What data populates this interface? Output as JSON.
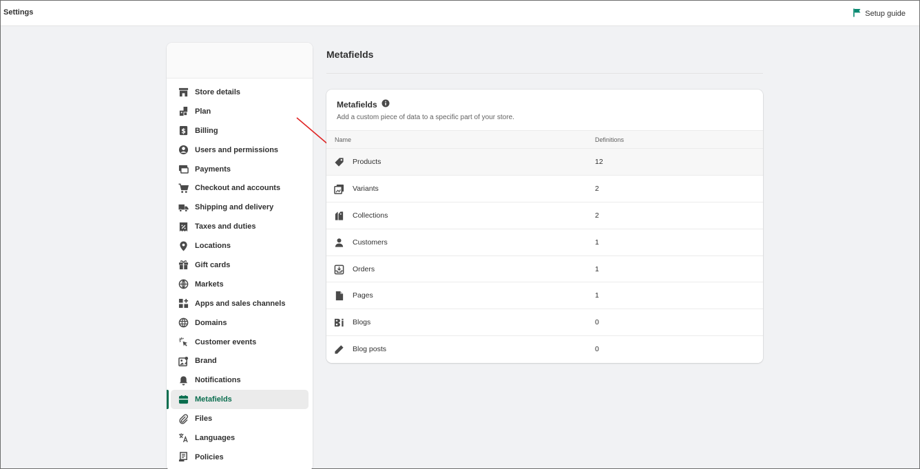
{
  "topbar": {
    "title": "Settings",
    "setup_guide_label": "Setup guide",
    "setup_guide_icon": "flag-icon",
    "accent": "#0b8a72"
  },
  "sidebar": {
    "items": [
      {
        "label": "Store details",
        "icon": "store-icon"
      },
      {
        "label": "Plan",
        "icon": "plan-icon"
      },
      {
        "label": "Billing",
        "icon": "billing-icon"
      },
      {
        "label": "Users and permissions",
        "icon": "user-circle-icon"
      },
      {
        "label": "Payments",
        "icon": "payments-icon"
      },
      {
        "label": "Checkout and accounts",
        "icon": "cart-icon"
      },
      {
        "label": "Shipping and delivery",
        "icon": "truck-icon"
      },
      {
        "label": "Taxes and duties",
        "icon": "tax-icon"
      },
      {
        "label": "Locations",
        "icon": "location-icon"
      },
      {
        "label": "Gift cards",
        "icon": "gift-icon"
      },
      {
        "label": "Markets",
        "icon": "globe-icon"
      },
      {
        "label": "Apps and sales channels",
        "icon": "apps-icon"
      },
      {
        "label": "Domains",
        "icon": "domain-icon"
      },
      {
        "label": "Customer events",
        "icon": "cursor-icon"
      },
      {
        "label": "Brand",
        "icon": "brand-icon"
      },
      {
        "label": "Notifications",
        "icon": "bell-icon"
      },
      {
        "label": "Metafields",
        "icon": "metafields-icon",
        "active": true
      },
      {
        "label": "Files",
        "icon": "paperclip-icon"
      },
      {
        "label": "Languages",
        "icon": "translate-icon"
      },
      {
        "label": "Policies",
        "icon": "policy-icon"
      }
    ],
    "active_color": "#0b6e4f"
  },
  "main": {
    "page_title": "Metafields",
    "card": {
      "title": "Metafields",
      "info_icon": "info-icon",
      "description": "Add a custom piece of data to a specific part of your store.",
      "columns": {
        "name": "Name",
        "definitions": "Definitions"
      },
      "rows": [
        {
          "name": "Products",
          "count": "12",
          "icon": "tag-icon"
        },
        {
          "name": "Variants",
          "count": "2",
          "icon": "variants-icon"
        },
        {
          "name": "Collections",
          "count": "2",
          "icon": "collection-icon"
        },
        {
          "name": "Customers",
          "count": "1",
          "icon": "person-icon"
        },
        {
          "name": "Orders",
          "count": "1",
          "icon": "order-icon"
        },
        {
          "name": "Pages",
          "count": "1",
          "icon": "page-icon"
        },
        {
          "name": "Blogs",
          "count": "0",
          "icon": "blog-icon"
        },
        {
          "name": "Blog posts",
          "count": "0",
          "icon": "pencil-icon"
        }
      ]
    }
  },
  "annotation": {
    "arrow_color": "#e02424"
  }
}
